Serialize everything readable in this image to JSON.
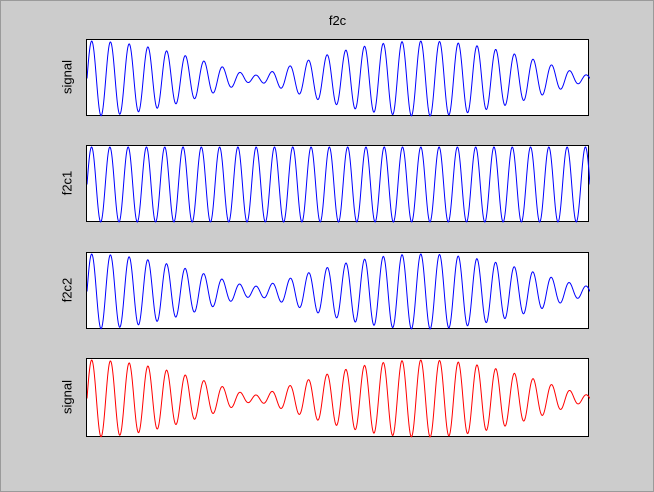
{
  "figure": {
    "background": "#cccccc",
    "title": "f2c"
  },
  "chart_data": [
    {
      "type": "line",
      "ylabel": "signal",
      "color": "#0000ff",
      "x": {
        "start": 0,
        "end": 1000,
        "step": 1
      },
      "components": [
        {
          "amplitude": 0.48,
          "cycles": 27.5,
          "phase": 0
        },
        {
          "amplitude": 0.4,
          "cycles": 26.0,
          "phase": 0
        }
      ]
    },
    {
      "type": "line",
      "ylabel": "f2c1",
      "color": "#0000ff",
      "x": {
        "start": 0,
        "end": 1000,
        "step": 1
      },
      "components": [
        {
          "amplitude": 0.78,
          "cycles": 27.5,
          "phase": 0
        }
      ]
    },
    {
      "type": "line",
      "ylabel": "f2c2",
      "color": "#0000ff",
      "x": {
        "start": 0,
        "end": 1000,
        "step": 1
      },
      "components": [
        {
          "amplitude": 0.4,
          "cycles": 27.5,
          "phase": 0
        },
        {
          "amplitude": 0.3,
          "cycles": 26.0,
          "phase": 0
        }
      ]
    },
    {
      "type": "line",
      "ylabel": "signal",
      "color": "#ff0000",
      "x": {
        "start": 0,
        "end": 1000,
        "step": 1
      },
      "components": [
        {
          "amplitude": 0.48,
          "cycles": 27.5,
          "phase": 0
        },
        {
          "amplitude": 0.4,
          "cycles": 26.0,
          "phase": 0
        }
      ]
    }
  ]
}
